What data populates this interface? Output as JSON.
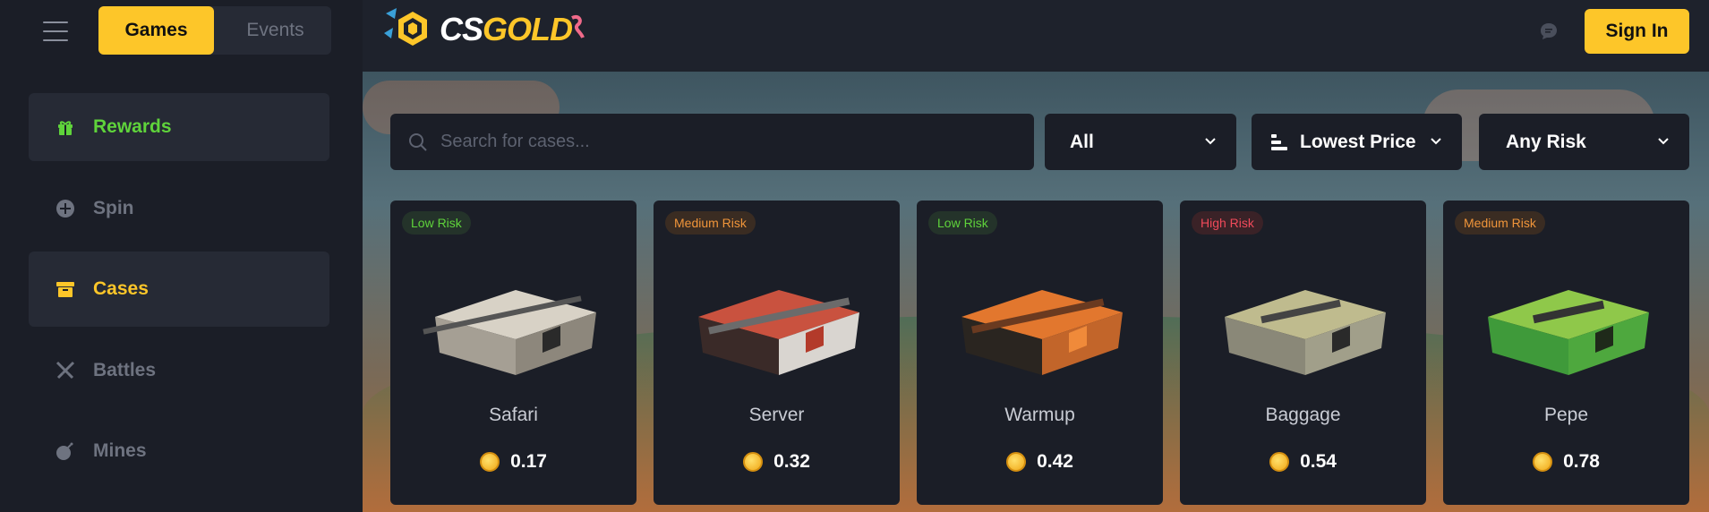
{
  "sidebar": {
    "top_tabs": {
      "games": "Games",
      "events": "Events"
    },
    "nav": [
      {
        "label": "Rewards",
        "icon": "gift-icon"
      },
      {
        "label": "Spin",
        "icon": "plus-circle-icon"
      },
      {
        "label": "Cases",
        "icon": "box-icon"
      },
      {
        "label": "Battles",
        "icon": "crossed-swords-icon"
      },
      {
        "label": "Mines",
        "icon": "bomb-icon"
      }
    ]
  },
  "header": {
    "logo": {
      "cs": "CS",
      "gold": "GOLD"
    },
    "sign_in": "Sign In"
  },
  "filters": {
    "search_placeholder": "Search for cases...",
    "category": "All",
    "sort": "Lowest Price",
    "risk": "Any Risk"
  },
  "cases": [
    {
      "name": "Safari",
      "risk": "Low Risk",
      "price": "0.17",
      "color": "#b9b3a6"
    },
    {
      "name": "Server",
      "risk": "Medium Risk",
      "price": "0.32",
      "color": "#b8463a"
    },
    {
      "name": "Warmup",
      "risk": "Low Risk",
      "price": "0.42",
      "color": "#e2772e"
    },
    {
      "name": "Baggage",
      "risk": "High Risk",
      "price": "0.54",
      "color": "#b8b48a"
    },
    {
      "name": "Pepe",
      "risk": "Medium Risk",
      "price": "0.78",
      "color": "#5fb23a"
    }
  ],
  "colors": {
    "accent": "#fdc629",
    "green": "#5fd33b",
    "orange": "#f0953a",
    "red": "#f04a5a"
  }
}
